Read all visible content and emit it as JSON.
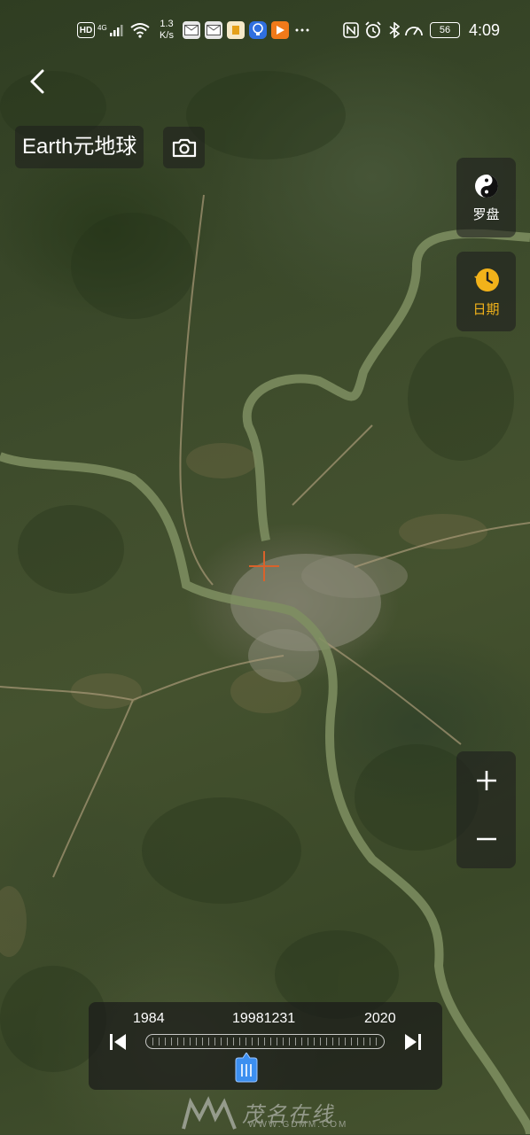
{
  "status_bar": {
    "hd": "HD",
    "network": "4G",
    "speed_value": "1.3",
    "speed_unit": "K/s",
    "battery": "56",
    "time": "4:09"
  },
  "header": {
    "app_title": "Earth元地球"
  },
  "side_controls": {
    "compass_label": "罗盘",
    "date_label": "日期"
  },
  "timeline": {
    "start_year": "1984",
    "current_date": "19981231",
    "end_year": "2020",
    "progress": 0.42
  },
  "watermark": {
    "text": "茂名在线",
    "url": "WWW.GDMM.COM"
  },
  "colors": {
    "accent": "#f2b21a",
    "thumb": "#3c8ff0",
    "crosshair": "#d9622b"
  }
}
